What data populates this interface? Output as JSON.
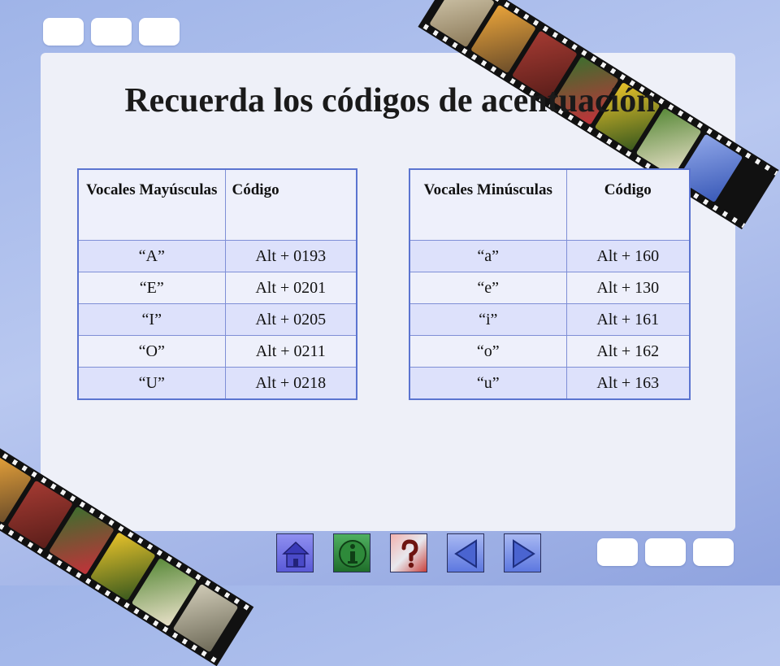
{
  "slide": {
    "title": "Recuerda los códigos de acentuación"
  },
  "uppercase_table": {
    "headers": [
      "Vocales Mayúsculas",
      "Código"
    ],
    "rows": [
      [
        "“A”",
        "Alt + 0193"
      ],
      [
        "“E”",
        "Alt + 0201"
      ],
      [
        "“I”",
        "Alt + 0205"
      ],
      [
        "“O”",
        "Alt + 0211"
      ],
      [
        "“U”",
        "Alt + 0218"
      ]
    ]
  },
  "lowercase_table": {
    "headers": [
      "Vocales Minúsculas",
      "Código"
    ],
    "rows": [
      [
        "“a”",
        "Alt + 160"
      ],
      [
        "“e”",
        "Alt + 130"
      ],
      [
        "“i”",
        "Alt + 161"
      ],
      [
        "“o”",
        "Alt + 162"
      ],
      [
        "“u”",
        "Alt + 163"
      ]
    ]
  },
  "nav_buttons": [
    {
      "icon": "home-icon"
    },
    {
      "icon": "info-icon"
    },
    {
      "icon": "help-icon"
    },
    {
      "icon": "previous-icon"
    },
    {
      "icon": "next-icon"
    }
  ],
  "colors": {
    "background": "#9fb4e8",
    "panel": "#eef0f8",
    "table_border": "#5b74d0",
    "row_alt": "#dde1fb",
    "nav_home": "#6b6be6",
    "nav_info": "#2e8a3a",
    "nav_help": "#c9413c",
    "nav_arrow": "#5d78e0"
  }
}
